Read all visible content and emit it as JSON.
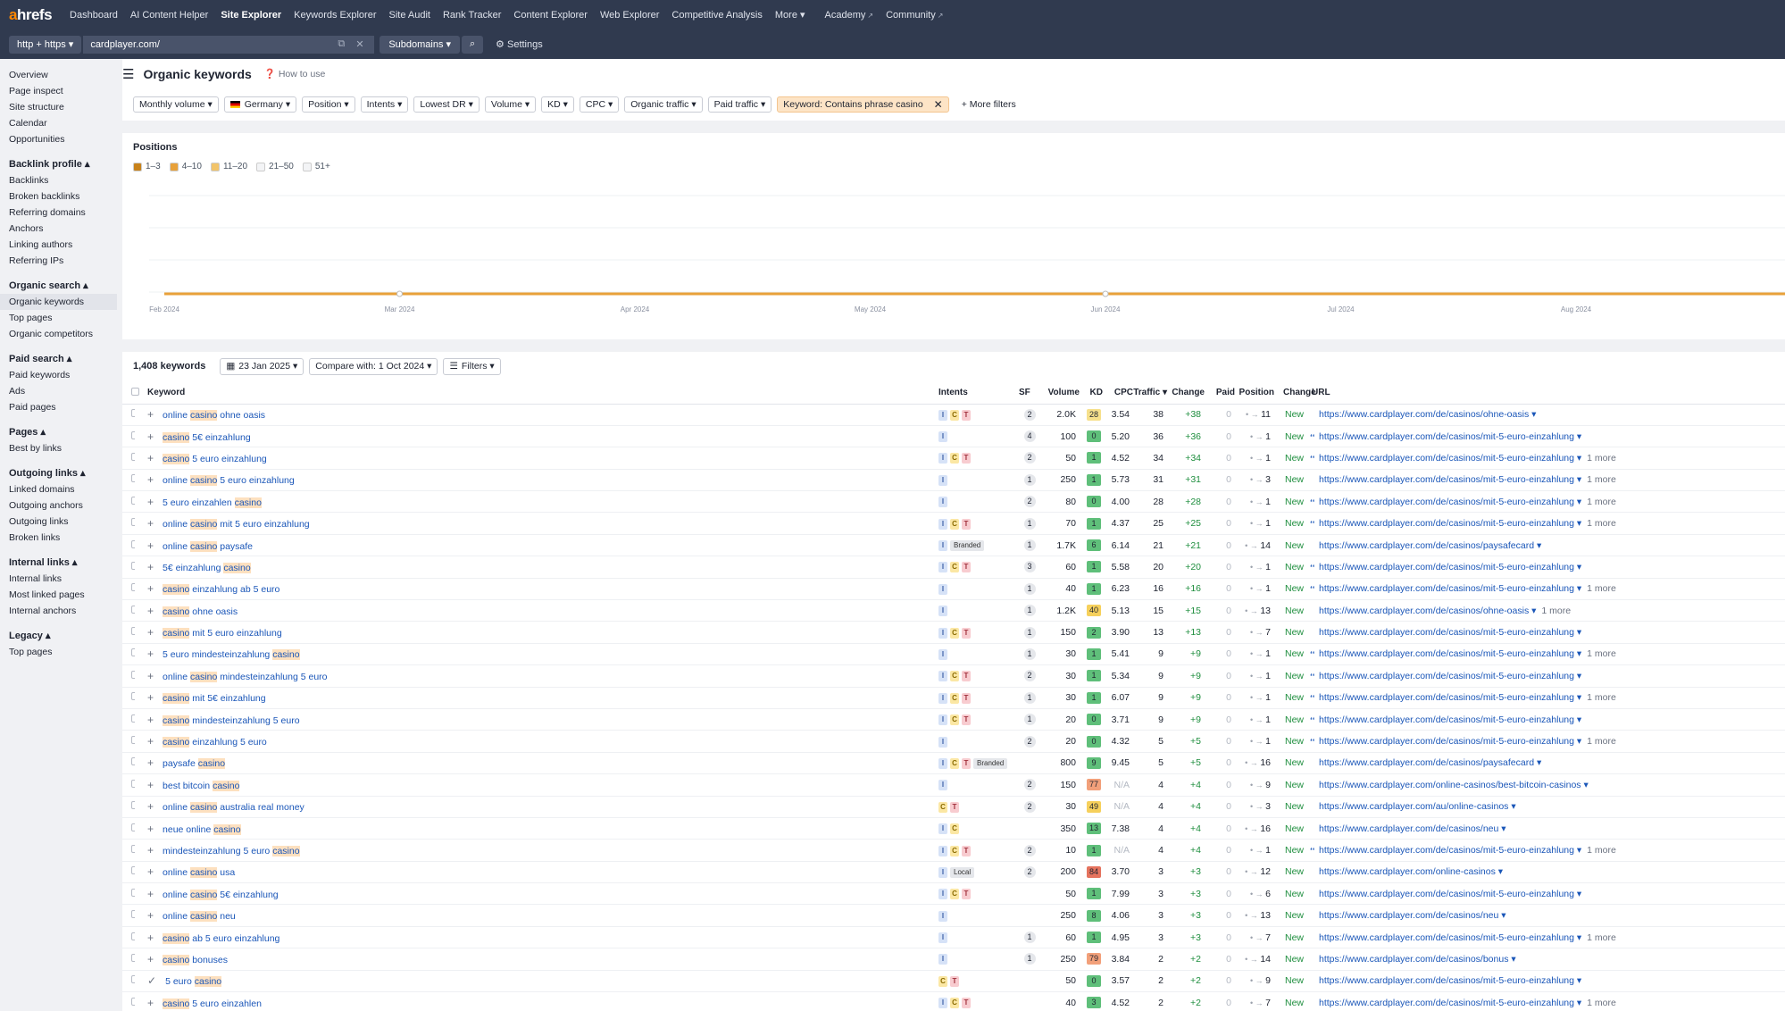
{
  "nav": {
    "logo_a": "a",
    "logo_rest": "hrefs",
    "items": [
      "Dashboard",
      "AI Content Helper",
      "Site Explorer",
      "Keywords Explorer",
      "Site Audit",
      "Rank Tracker",
      "Content Explorer",
      "Web Explorer",
      "Competitive Analysis",
      "More ▾",
      "Academy",
      "Community"
    ]
  },
  "search": {
    "protocol": "http + https ▾",
    "url": "cardplayer.com/",
    "mode": "Subdomains ▾",
    "settings": "Settings"
  },
  "sidebar": {
    "top": [
      "Overview",
      "Page inspect",
      "Site structure",
      "Calendar",
      "Opportunities"
    ],
    "sections": [
      {
        "title": "Backlink profile ▴",
        "items": [
          "Backlinks",
          "Broken backlinks",
          "Referring domains",
          "Anchors",
          "Linking authors",
          "Referring IPs"
        ]
      },
      {
        "title": "Organic search ▴",
        "items": [
          "Organic keywords",
          "Top pages",
          "Organic competitors"
        ]
      },
      {
        "title": "Paid search ▴",
        "items": [
          "Paid keywords",
          "Ads",
          "Paid pages"
        ]
      },
      {
        "title": "Pages ▴",
        "items": [
          "Best by links"
        ]
      },
      {
        "title": "Outgoing links ▴",
        "items": [
          "Linked domains",
          "Outgoing anchors",
          "Outgoing links",
          "Broken links"
        ]
      },
      {
        "title": "Internal links ▴",
        "items": [
          "Internal links",
          "Most linked pages",
          "Internal anchors"
        ]
      },
      {
        "title": "Legacy ▴",
        "items": [
          "Top pages"
        ]
      }
    ]
  },
  "header": {
    "title": "Organic keywords",
    "howto": "How to use"
  },
  "filters": [
    "Monthly volume ▾",
    "Germany ▾",
    "Position ▾",
    "Intents ▾",
    "Lowest DR ▾",
    "Volume ▾",
    "KD ▾",
    "CPC ▾",
    "Organic traffic ▾",
    "Paid traffic ▾"
  ],
  "keyword_filter": "Keyword: Contains phrase casino",
  "more_filters": "More filters",
  "positions": {
    "title": "Positions",
    "legend": [
      "1–3",
      "4–10",
      "11–20",
      "21–50",
      "51+"
    ]
  },
  "chart_data": {
    "type": "line",
    "x": [
      "Feb 2024",
      "Mar 2024",
      "Apr 2024",
      "May 2024",
      "Jun 2024",
      "Jul 2024",
      "Aug 2024"
    ],
    "colors": {
      "1-3": "#e8a13a",
      "4-10": "#f2c46a",
      "11-20": "#f7d9a0"
    }
  },
  "table_bar": {
    "count": "1,408 keywords",
    "date": "23 Jan 2025 ▾",
    "compare": "Compare with: 1 Oct 2024 ▾",
    "filters": "Filters ▾"
  },
  "columns": [
    "Keyword",
    "Intents",
    "SF",
    "Volume",
    "KD",
    "CPC",
    "Traffic ▾",
    "Change",
    "Paid",
    "Position",
    "Change",
    "URL"
  ],
  "rows": [
    {
      "kw": [
        "online ",
        "casino",
        " ohne oasis"
      ],
      "intents": [
        "I",
        "C",
        "T"
      ],
      "tags": [],
      "sf": "2",
      "vol": "2.0K",
      "kd": "28",
      "kdc": "#f6e08c",
      "cpc": "3.54",
      "traffic": "38",
      "chg": "+38",
      "paid": "0",
      "pos": "11",
      "pchg": "New",
      "url": "https://www.cardplayer.com/de/casinos/ohne-oasis ▾",
      "more": "",
      "cur": false
    },
    {
      "kw": [
        "",
        "casino",
        " 5€ einzahlung"
      ],
      "intents": [
        "I"
      ],
      "tags": [],
      "sf": "4",
      "vol": "100",
      "kd": "0",
      "kdc": "#5fbf7a",
      "cpc": "5.20",
      "traffic": "36",
      "chg": "+36",
      "paid": "0",
      "pos": "1",
      "pchg": "New",
      "url": "https://www.cardplayer.com/de/casinos/mit-5-euro-einzahlung ▾",
      "more": "",
      "cur": true
    },
    {
      "kw": [
        "",
        "casino",
        " 5 euro einzahlung"
      ],
      "intents": [
        "I",
        "C",
        "T"
      ],
      "tags": [],
      "sf": "2",
      "vol": "50",
      "kd": "1",
      "kdc": "#5fbf7a",
      "cpc": "4.52",
      "traffic": "34",
      "chg": "+34",
      "paid": "0",
      "pos": "1",
      "pchg": "New",
      "url": "https://www.cardplayer.com/de/casinos/mit-5-euro-einzahlung ▾",
      "more": "1 more",
      "cur": true
    },
    {
      "kw": [
        "online ",
        "casino",
        " 5 euro einzahlung"
      ],
      "intents": [
        "I"
      ],
      "tags": [],
      "sf": "1",
      "vol": "250",
      "kd": "1",
      "kdc": "#5fbf7a",
      "cpc": "5.73",
      "traffic": "31",
      "chg": "+31",
      "paid": "0",
      "pos": "3",
      "pchg": "New",
      "url": "https://www.cardplayer.com/de/casinos/mit-5-euro-einzahlung ▾",
      "more": "1 more",
      "cur": false
    },
    {
      "kw": [
        "5 euro einzahlen ",
        "casino",
        ""
      ],
      "intents": [
        "I"
      ],
      "tags": [],
      "sf": "2",
      "vol": "80",
      "kd": "0",
      "kdc": "#5fbf7a",
      "cpc": "4.00",
      "traffic": "28",
      "chg": "+28",
      "paid": "0",
      "pos": "1",
      "pchg": "New",
      "url": "https://www.cardplayer.com/de/casinos/mit-5-euro-einzahlung ▾",
      "more": "1 more",
      "cur": true
    },
    {
      "kw": [
        "online ",
        "casino",
        " mit 5 euro einzahlung"
      ],
      "intents": [
        "I",
        "C",
        "T"
      ],
      "tags": [],
      "sf": "1",
      "vol": "70",
      "kd": "1",
      "kdc": "#5fbf7a",
      "cpc": "4.37",
      "traffic": "25",
      "chg": "+25",
      "paid": "0",
      "pos": "1",
      "pchg": "New",
      "url": "https://www.cardplayer.com/de/casinos/mit-5-euro-einzahlung ▾",
      "more": "1 more",
      "cur": true
    },
    {
      "kw": [
        "online ",
        "casino",
        " paysafe"
      ],
      "intents": [
        "I"
      ],
      "tags": [
        "Branded"
      ],
      "sf": "1",
      "vol": "1.7K",
      "kd": "6",
      "kdc": "#5fbf7a",
      "cpc": "6.14",
      "traffic": "21",
      "chg": "+21",
      "paid": "0",
      "pos": "14",
      "pchg": "New",
      "url": "https://www.cardplayer.com/de/casinos/paysafecard ▾",
      "more": "",
      "cur": false
    },
    {
      "kw": [
        "5€ einzahlung ",
        "casino",
        ""
      ],
      "intents": [
        "I",
        "C",
        "T"
      ],
      "tags": [],
      "sf": "3",
      "vol": "60",
      "kd": "1",
      "kdc": "#5fbf7a",
      "cpc": "5.58",
      "traffic": "20",
      "chg": "+20",
      "paid": "0",
      "pos": "1",
      "pchg": "New",
      "url": "https://www.cardplayer.com/de/casinos/mit-5-euro-einzahlung ▾",
      "more": "",
      "cur": true
    },
    {
      "kw": [
        "",
        "casino",
        " einzahlung ab 5 euro"
      ],
      "intents": [
        "I"
      ],
      "tags": [],
      "sf": "1",
      "vol": "40",
      "kd": "1",
      "kdc": "#5fbf7a",
      "cpc": "6.23",
      "traffic": "16",
      "chg": "+16",
      "paid": "0",
      "pos": "1",
      "pchg": "New",
      "url": "https://www.cardplayer.com/de/casinos/mit-5-euro-einzahlung ▾",
      "more": "1 more",
      "cur": true
    },
    {
      "kw": [
        "",
        "casino",
        " ohne oasis"
      ],
      "intents": [
        "I"
      ],
      "tags": [],
      "sf": "1",
      "vol": "1.2K",
      "kd": "40",
      "kdc": "#f6d05c",
      "cpc": "5.13",
      "traffic": "15",
      "chg": "+15",
      "paid": "0",
      "pos": "13",
      "pchg": "New",
      "url": "https://www.cardplayer.com/de/casinos/ohne-oasis ▾",
      "more": "1 more",
      "cur": false
    },
    {
      "kw": [
        "",
        "casino",
        " mit 5 euro einzahlung"
      ],
      "intents": [
        "I",
        "C",
        "T"
      ],
      "tags": [],
      "sf": "1",
      "vol": "150",
      "kd": "2",
      "kdc": "#5fbf7a",
      "cpc": "3.90",
      "traffic": "13",
      "chg": "+13",
      "paid": "0",
      "pos": "7",
      "pchg": "New",
      "url": "https://www.cardplayer.com/de/casinos/mit-5-euro-einzahlung ▾",
      "more": "",
      "cur": false
    },
    {
      "kw": [
        "5 euro mindesteinzahlung ",
        "casino",
        ""
      ],
      "intents": [
        "I"
      ],
      "tags": [],
      "sf": "1",
      "vol": "30",
      "kd": "1",
      "kdc": "#5fbf7a",
      "cpc": "5.41",
      "traffic": "9",
      "chg": "+9",
      "paid": "0",
      "pos": "1",
      "pchg": "New",
      "url": "https://www.cardplayer.com/de/casinos/mit-5-euro-einzahlung ▾",
      "more": "1 more",
      "cur": true
    },
    {
      "kw": [
        "online ",
        "casino",
        " mindesteinzahlung 5 euro"
      ],
      "intents": [
        "I",
        "C",
        "T"
      ],
      "tags": [],
      "sf": "2",
      "vol": "30",
      "kd": "1",
      "kdc": "#5fbf7a",
      "cpc": "5.34",
      "traffic": "9",
      "chg": "+9",
      "paid": "0",
      "pos": "1",
      "pchg": "New",
      "url": "https://www.cardplayer.com/de/casinos/mit-5-euro-einzahlung ▾",
      "more": "",
      "cur": true
    },
    {
      "kw": [
        "",
        "casino",
        " mit 5€ einzahlung"
      ],
      "intents": [
        "I",
        "C",
        "T"
      ],
      "tags": [],
      "sf": "1",
      "vol": "30",
      "kd": "1",
      "kdc": "#5fbf7a",
      "cpc": "6.07",
      "traffic": "9",
      "chg": "+9",
      "paid": "0",
      "pos": "1",
      "pchg": "New",
      "url": "https://www.cardplayer.com/de/casinos/mit-5-euro-einzahlung ▾",
      "more": "1 more",
      "cur": true
    },
    {
      "kw": [
        "",
        "casino",
        " mindesteinzahlung 5 euro"
      ],
      "intents": [
        "I",
        "C",
        "T"
      ],
      "tags": [],
      "sf": "1",
      "vol": "20",
      "kd": "0",
      "kdc": "#5fbf7a",
      "cpc": "3.71",
      "traffic": "9",
      "chg": "+9",
      "paid": "0",
      "pos": "1",
      "pchg": "New",
      "url": "https://www.cardplayer.com/de/casinos/mit-5-euro-einzahlung ▾",
      "more": "",
      "cur": true
    },
    {
      "kw": [
        "",
        "casino",
        " einzahlung 5 euro"
      ],
      "intents": [
        "I"
      ],
      "tags": [],
      "sf": "2",
      "vol": "20",
      "kd": "0",
      "kdc": "#5fbf7a",
      "cpc": "4.32",
      "traffic": "5",
      "chg": "+5",
      "paid": "0",
      "pos": "1",
      "pchg": "New",
      "url": "https://www.cardplayer.com/de/casinos/mit-5-euro-einzahlung ▾",
      "more": "1 more",
      "cur": true
    },
    {
      "kw": [
        "paysafe ",
        "casino",
        ""
      ],
      "intents": [
        "I",
        "C",
        "T"
      ],
      "tags": [
        "Branded"
      ],
      "sf": "",
      "vol": "800",
      "kd": "9",
      "kdc": "#5fbf7a",
      "cpc": "9.45",
      "traffic": "5",
      "chg": "+5",
      "paid": "0",
      "pos": "16",
      "pchg": "New",
      "url": "https://www.cardplayer.com/de/casinos/paysafecard ▾",
      "more": "",
      "cur": false
    },
    {
      "kw": [
        "best bitcoin ",
        "casino",
        ""
      ],
      "intents": [
        "I"
      ],
      "tags": [],
      "sf": "2",
      "vol": "150",
      "kd": "77",
      "kdc": "#f2a07a",
      "cpc": "N/A",
      "traffic": "4",
      "chg": "+4",
      "paid": "0",
      "pos": "9",
      "pchg": "New",
      "url": "https://www.cardplayer.com/online-casinos/best-bitcoin-casinos ▾",
      "more": "",
      "cur": false
    },
    {
      "kw": [
        "online ",
        "casino",
        " australia real money"
      ],
      "intents": [
        "C",
        "T"
      ],
      "tags": [],
      "sf": "2",
      "vol": "30",
      "kd": "49",
      "kdc": "#f6d05c",
      "cpc": "N/A",
      "traffic": "4",
      "chg": "+4",
      "paid": "0",
      "pos": "3",
      "pchg": "New",
      "url": "https://www.cardplayer.com/au/online-casinos ▾",
      "more": "",
      "cur": false
    },
    {
      "kw": [
        "neue online ",
        "casino",
        ""
      ],
      "intents": [
        "I",
        "C"
      ],
      "tags": [],
      "sf": "",
      "vol": "350",
      "kd": "13",
      "kdc": "#5fbf7a",
      "cpc": "7.38",
      "traffic": "4",
      "chg": "+4",
      "paid": "0",
      "pos": "16",
      "pchg": "New",
      "url": "https://www.cardplayer.com/de/casinos/neu ▾",
      "more": "",
      "cur": false
    },
    {
      "kw": [
        "mindesteinzahlung 5 euro ",
        "casino",
        ""
      ],
      "intents": [
        "I",
        "C",
        "T"
      ],
      "tags": [],
      "sf": "2",
      "vol": "10",
      "kd": "1",
      "kdc": "#5fbf7a",
      "cpc": "N/A",
      "traffic": "4",
      "chg": "+4",
      "paid": "0",
      "pos": "1",
      "pchg": "New",
      "url": "https://www.cardplayer.com/de/casinos/mit-5-euro-einzahlung ▾",
      "more": "1 more",
      "cur": true
    },
    {
      "kw": [
        "online ",
        "casino",
        " usa"
      ],
      "intents": [
        "I"
      ],
      "tags": [
        "Local"
      ],
      "sf": "2",
      "vol": "200",
      "kd": "84",
      "kdc": "#e5735e",
      "cpc": "3.70",
      "traffic": "3",
      "chg": "+3",
      "paid": "0",
      "pos": "12",
      "pchg": "New",
      "url": "https://www.cardplayer.com/online-casinos ▾",
      "more": "",
      "cur": false
    },
    {
      "kw": [
        "online ",
        "casino",
        " 5€ einzahlung"
      ],
      "intents": [
        "I",
        "C",
        "T"
      ],
      "tags": [],
      "sf": "",
      "vol": "50",
      "kd": "1",
      "kdc": "#5fbf7a",
      "cpc": "7.99",
      "traffic": "3",
      "chg": "+3",
      "paid": "0",
      "pos": "6",
      "pchg": "New",
      "url": "https://www.cardplayer.com/de/casinos/mit-5-euro-einzahlung ▾",
      "more": "",
      "cur": false
    },
    {
      "kw": [
        "online ",
        "casino",
        " neu"
      ],
      "intents": [
        "I"
      ],
      "tags": [],
      "sf": "",
      "vol": "250",
      "kd": "8",
      "kdc": "#5fbf7a",
      "cpc": "4.06",
      "traffic": "3",
      "chg": "+3",
      "paid": "0",
      "pos": "13",
      "pchg": "New",
      "url": "https://www.cardplayer.com/de/casinos/neu ▾",
      "more": "",
      "cur": false
    },
    {
      "kw": [
        "",
        "casino",
        " ab 5 euro einzahlung"
      ],
      "intents": [
        "I"
      ],
      "tags": [],
      "sf": "1",
      "vol": "60",
      "kd": "1",
      "kdc": "#5fbf7a",
      "cpc": "4.95",
      "traffic": "3",
      "chg": "+3",
      "paid": "0",
      "pos": "7",
      "pchg": "New",
      "url": "https://www.cardplayer.com/de/casinos/mit-5-euro-einzahlung ▾",
      "more": "1 more",
      "cur": false
    },
    {
      "kw": [
        "",
        "casino",
        " bonuses"
      ],
      "intents": [
        "I"
      ],
      "tags": [],
      "sf": "1",
      "vol": "250",
      "kd": "79",
      "kdc": "#f2a07a",
      "cpc": "3.84",
      "traffic": "2",
      "chg": "+2",
      "paid": "0",
      "pos": "14",
      "pchg": "New",
      "url": "https://www.cardplayer.com/de/casinos/bonus ▾",
      "more": "",
      "cur": false
    },
    {
      "kw": [
        "5 euro ",
        "casino",
        ""
      ],
      "intents": [
        "C",
        "T"
      ],
      "tags": [],
      "sf": "",
      "vol": "50",
      "kd": "0",
      "kdc": "#5fbf7a",
      "cpc": "3.57",
      "traffic": "2",
      "chg": "+2",
      "paid": "0",
      "pos": "9",
      "pchg": "New",
      "url": "https://www.cardplayer.com/de/casinos/mit-5-euro-einzahlung ▾",
      "more": "",
      "cur": false
    },
    {
      "kw": [
        "",
        "casino",
        " 5 euro einzahlen"
      ],
      "intents": [
        "I",
        "C",
        "T"
      ],
      "tags": [],
      "sf": "",
      "vol": "40",
      "kd": "3",
      "kdc": "#5fbf7a",
      "cpc": "4.52",
      "traffic": "2",
      "chg": "+2",
      "paid": "0",
      "pos": "7",
      "pchg": "New",
      "url": "https://www.cardplayer.com/de/casinos/mit-5-euro-einzahlung ▾",
      "more": "1 more",
      "cur": false
    }
  ]
}
